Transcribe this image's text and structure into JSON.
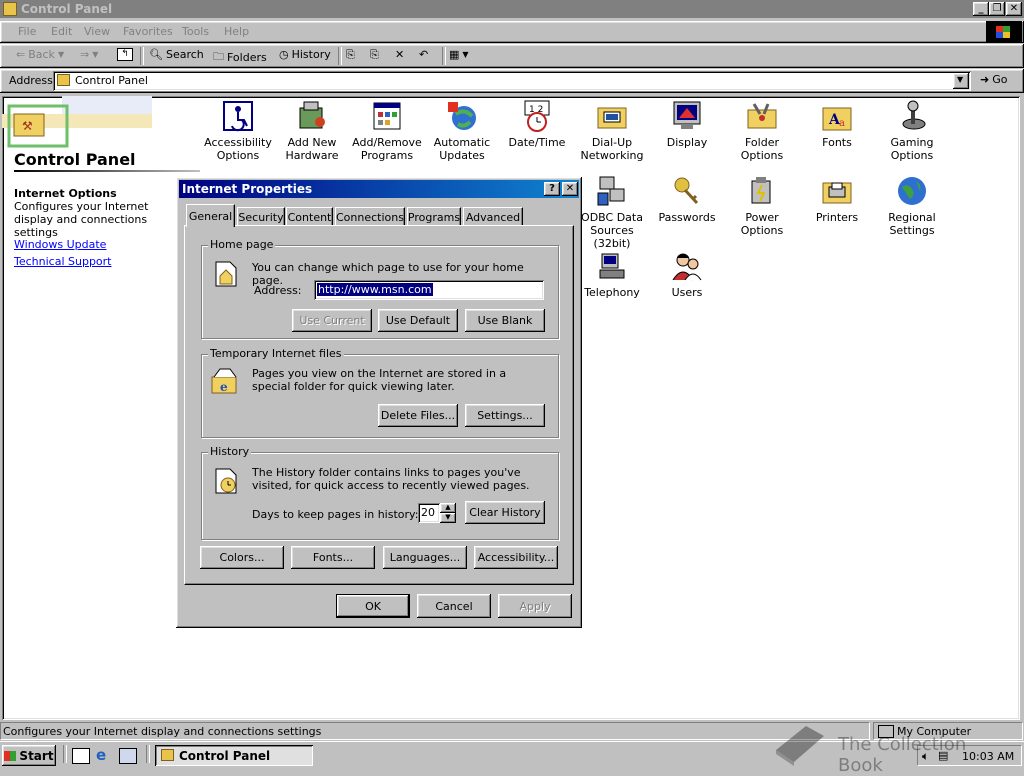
{
  "window": {
    "title": "Control Panel"
  },
  "menu": [
    "File",
    "Edit",
    "View",
    "Favorites",
    "Tools",
    "Help"
  ],
  "toolbar": {
    "back": "Back",
    "search": "Search",
    "folders": "Folders",
    "history": "History"
  },
  "address": {
    "label": "Address",
    "value": "Control Panel",
    "go": "Go"
  },
  "leftpane": {
    "title": "Control Panel",
    "selected_item": "Internet Options",
    "selected_desc": "Configures your Internet display and connections settings",
    "links": [
      "Windows Update",
      "Technical Support"
    ]
  },
  "icons": [
    {
      "label": "Accessibility Options",
      "icon": "accessibility-icon"
    },
    {
      "label": "Add New Hardware",
      "icon": "hardware-icon"
    },
    {
      "label": "Add/Remove Programs",
      "icon": "programs-icon"
    },
    {
      "label": "Automatic Updates",
      "icon": "updates-icon"
    },
    {
      "label": "Date/Time",
      "icon": "clock-icon"
    },
    {
      "label": "Dial-Up Networking",
      "icon": "network-icon"
    },
    {
      "label": "Display",
      "icon": "display-icon"
    },
    {
      "label": "Folder Options",
      "icon": "folder-options-icon"
    },
    {
      "label": "Fonts",
      "icon": "fonts-icon"
    },
    {
      "label": "Gaming Options",
      "icon": "joystick-icon"
    },
    {
      "label": "ODBC Data Sources (32bit)",
      "icon": "odbc-icon"
    },
    {
      "label": "Passwords",
      "icon": "keys-icon"
    },
    {
      "label": "Power Options",
      "icon": "power-icon"
    },
    {
      "label": "Printers",
      "icon": "printer-icon"
    },
    {
      "label": "Regional Settings",
      "icon": "globe-icon"
    },
    {
      "label": "Telephony",
      "icon": "telephony-icon"
    },
    {
      "label": "Users",
      "icon": "users-icon"
    }
  ],
  "dialog": {
    "title": "Internet Properties",
    "tabs": [
      "General",
      "Security",
      "Content",
      "Connections",
      "Programs",
      "Advanced"
    ],
    "homepage": {
      "group": "Home page",
      "text": "You can change which page to use for your home page.",
      "address_label": "Address:",
      "address_value": "http://www.msn.com",
      "use_current": "Use Current",
      "use_default": "Use Default",
      "use_blank": "Use Blank"
    },
    "temp": {
      "group": "Temporary Internet files",
      "text": "Pages you view on the Internet are stored in a special folder for quick viewing later.",
      "delete": "Delete Files...",
      "settings": "Settings..."
    },
    "history": {
      "group": "History",
      "text": "The History folder contains links to pages you've visited, for quick access to recently viewed pages.",
      "days_label": "Days to keep pages in history:",
      "days_value": "20",
      "clear": "Clear History"
    },
    "bottom_buttons": [
      "Colors...",
      "Fonts...",
      "Languages...",
      "Accessibility..."
    ],
    "ok": "OK",
    "cancel": "Cancel",
    "apply": "Apply"
  },
  "status": {
    "text": "Configures your Internet display and connections settings",
    "zone": "My Computer"
  },
  "taskbar": {
    "start": "Start",
    "task": "Control Panel",
    "time": "10:03 AM"
  },
  "watermark": "The Collection Book"
}
